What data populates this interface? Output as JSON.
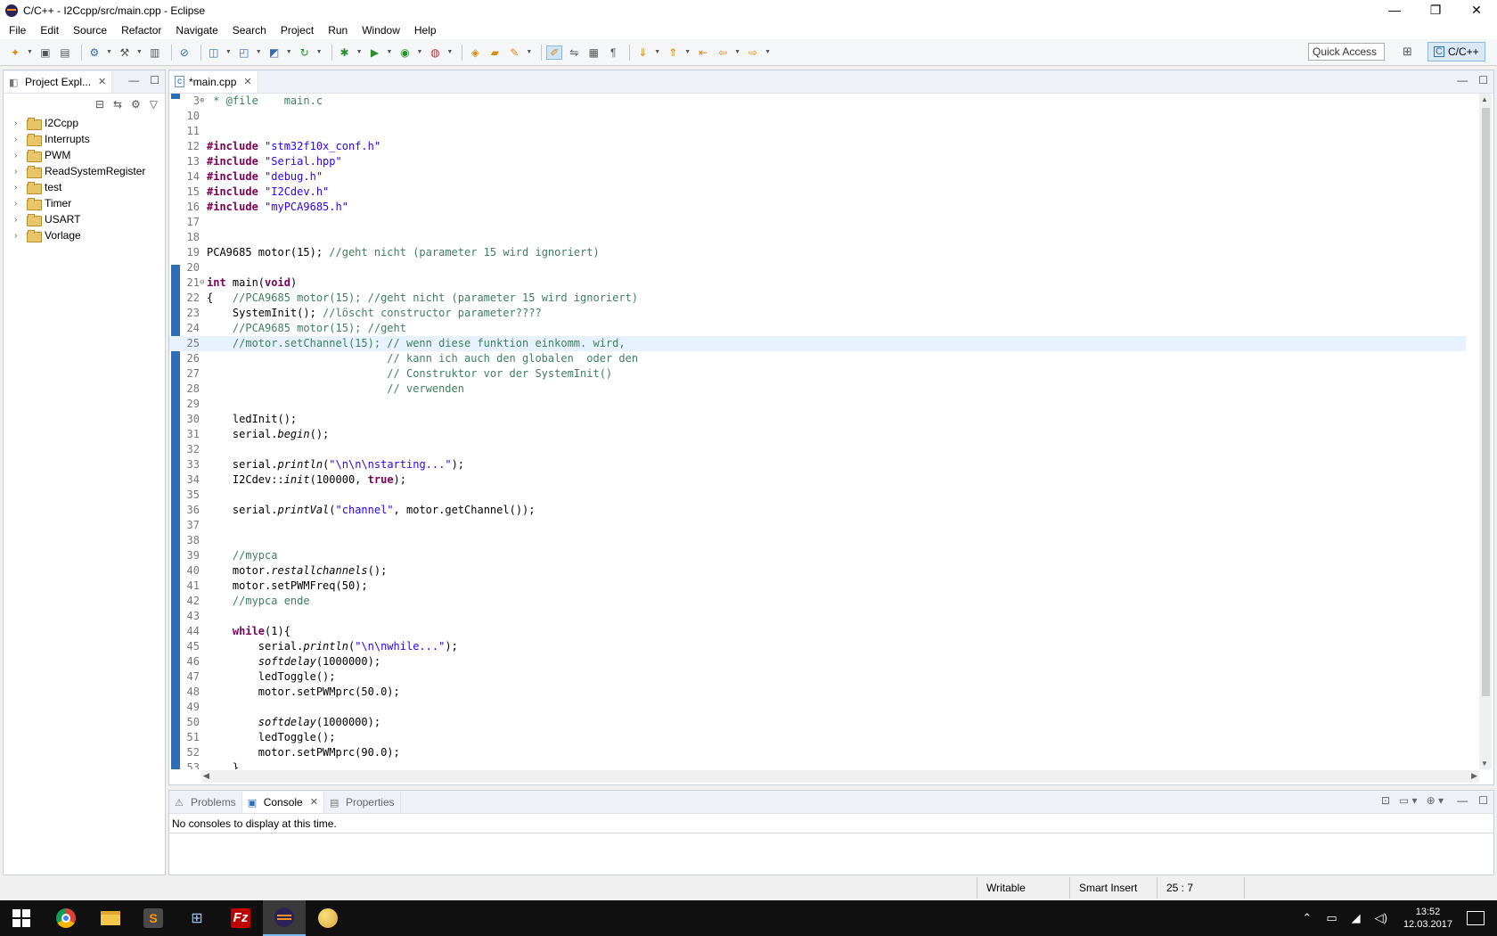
{
  "window": {
    "title": "C/C++ - I2Ccpp/src/main.cpp - Eclipse",
    "controls": [
      "—",
      "❐",
      "✕"
    ]
  },
  "menu": [
    "File",
    "Edit",
    "Source",
    "Refactor",
    "Navigate",
    "Search",
    "Project",
    "Run",
    "Window",
    "Help"
  ],
  "toolbar": {
    "quick_access": "Quick Access",
    "perspective": "C/C++",
    "accent": "#2f6db5"
  },
  "explorer": {
    "tab_label": "Project Expl...",
    "projects": [
      "I2Ccpp",
      "Interrupts",
      "PWM",
      "ReadSystemRegister",
      "test",
      "Timer",
      "USART",
      "Vorlage"
    ]
  },
  "editor": {
    "tab_label": "*main.cpp",
    "current_line": 25,
    "lines": [
      {
        "n": "3",
        "fold": "⊕",
        "parts": [
          [
            "cm",
            " * @file    main.c"
          ]
        ]
      },
      {
        "n": "10",
        "parts": []
      },
      {
        "n": "11",
        "parts": []
      },
      {
        "n": "12",
        "parts": [
          [
            "pp",
            "#include "
          ],
          [
            "str",
            "\"stm32f10x_conf.h\""
          ]
        ]
      },
      {
        "n": "13",
        "parts": [
          [
            "pp",
            "#include "
          ],
          [
            "str",
            "\"Serial.hpp\""
          ]
        ]
      },
      {
        "n": "14",
        "parts": [
          [
            "pp",
            "#include "
          ],
          [
            "str",
            "\"debug.h\""
          ]
        ]
      },
      {
        "n": "15",
        "parts": [
          [
            "pp",
            "#include "
          ],
          [
            "str",
            "\"I2Cdev.h\""
          ]
        ]
      },
      {
        "n": "16",
        "parts": [
          [
            "pp",
            "#include "
          ],
          [
            "str",
            "\"myPCA9685.h\""
          ]
        ]
      },
      {
        "n": "17",
        "parts": []
      },
      {
        "n": "18",
        "parts": []
      },
      {
        "n": "19",
        "parts": [
          [
            "",
            "PCA9685 motor(15); "
          ],
          [
            "cm",
            "//geht nicht (parameter 15 wird ignoriert)"
          ]
        ]
      },
      {
        "n": "20",
        "parts": []
      },
      {
        "n": "21",
        "fold": "⊖",
        "parts": [
          [
            "kw",
            "int"
          ],
          [
            "",
            " main("
          ],
          [
            "kw",
            "void"
          ],
          [
            "",
            ")"
          ]
        ]
      },
      {
        "n": "22",
        "parts": [
          [
            "",
            "{   "
          ],
          [
            "cm",
            "//PCA9685 motor(15); //geht nicht (parameter 15 wird ignoriert)"
          ]
        ]
      },
      {
        "n": "23",
        "parts": [
          [
            "",
            "    SystemInit(); "
          ],
          [
            "cm",
            "//löscht constructor parameter????"
          ]
        ]
      },
      {
        "n": "24",
        "parts": [
          [
            "cm",
            "    //PCA9685 motor(15); //geht"
          ]
        ]
      },
      {
        "n": "25",
        "parts": [
          [
            "cm",
            "    //motor.setChannel(15); // wenn diese funktion einkomm. wird,"
          ]
        ]
      },
      {
        "n": "26",
        "parts": [
          [
            "cm",
            "                            // kann ich auch den globalen  oder den"
          ]
        ]
      },
      {
        "n": "27",
        "parts": [
          [
            "cm",
            "                            // Construktor vor der SystemInit()"
          ]
        ]
      },
      {
        "n": "28",
        "parts": [
          [
            "cm",
            "                            // verwenden"
          ]
        ]
      },
      {
        "n": "29",
        "parts": []
      },
      {
        "n": "30",
        "parts": [
          [
            "",
            "    ledInit();"
          ]
        ]
      },
      {
        "n": "31",
        "parts": [
          [
            "",
            "    serial."
          ],
          [
            "it",
            "begin"
          ],
          [
            "",
            "();"
          ]
        ]
      },
      {
        "n": "32",
        "parts": []
      },
      {
        "n": "33",
        "parts": [
          [
            "",
            "    serial."
          ],
          [
            "it",
            "println"
          ],
          [
            "",
            "("
          ],
          [
            "str",
            "\"\\n\\n\\nstarting...\""
          ],
          [
            "",
            ");"
          ]
        ]
      },
      {
        "n": "34",
        "parts": [
          [
            "",
            "    I2Cdev::"
          ],
          [
            "it",
            "init"
          ],
          [
            "",
            "(100000, "
          ],
          [
            "kw",
            "true"
          ],
          [
            "",
            ");"
          ]
        ]
      },
      {
        "n": "35",
        "parts": []
      },
      {
        "n": "36",
        "parts": [
          [
            "",
            "    serial."
          ],
          [
            "it",
            "printVal"
          ],
          [
            "",
            "("
          ],
          [
            "str",
            "\"channel\""
          ],
          [
            "",
            ", motor.getChannel());"
          ]
        ]
      },
      {
        "n": "37",
        "parts": []
      },
      {
        "n": "38",
        "parts": []
      },
      {
        "n": "39",
        "parts": [
          [
            "cm",
            "    //mypca"
          ]
        ]
      },
      {
        "n": "40",
        "parts": [
          [
            "",
            "    motor."
          ],
          [
            "it",
            "restallchannels"
          ],
          [
            "",
            "();"
          ]
        ]
      },
      {
        "n": "41",
        "parts": [
          [
            "",
            "    motor.setPWMFreq(50);"
          ]
        ]
      },
      {
        "n": "42",
        "parts": [
          [
            "cm",
            "    //mypca ende"
          ]
        ]
      },
      {
        "n": "43",
        "parts": []
      },
      {
        "n": "44",
        "parts": [
          [
            "kw",
            "    while"
          ],
          [
            "",
            "(1){"
          ]
        ]
      },
      {
        "n": "45",
        "parts": [
          [
            "",
            "        serial."
          ],
          [
            "it",
            "println"
          ],
          [
            "",
            "("
          ],
          [
            "str",
            "\"\\n\\nwhile...\""
          ],
          [
            "",
            ");"
          ]
        ]
      },
      {
        "n": "46",
        "parts": [
          [
            "",
            "        "
          ],
          [
            "it",
            "softdelay"
          ],
          [
            "",
            "(1000000);"
          ]
        ]
      },
      {
        "n": "47",
        "parts": [
          [
            "",
            "        ledToggle();"
          ]
        ]
      },
      {
        "n": "48",
        "parts": [
          [
            "",
            "        motor.setPWMprc(50.0);"
          ]
        ]
      },
      {
        "n": "49",
        "parts": []
      },
      {
        "n": "50",
        "parts": [
          [
            "",
            "        "
          ],
          [
            "it",
            "softdelay"
          ],
          [
            "",
            "(1000000);"
          ]
        ]
      },
      {
        "n": "51",
        "parts": [
          [
            "",
            "        ledToggle();"
          ]
        ]
      },
      {
        "n": "52",
        "parts": [
          [
            "",
            "        motor.setPWMprc(90.0);"
          ]
        ]
      },
      {
        "n": "53",
        "parts": [
          [
            "",
            "    }"
          ]
        ]
      }
    ]
  },
  "bottom": {
    "tabs": [
      "Problems",
      "Console",
      "Properties"
    ],
    "active_tab": "Console",
    "message": "No consoles to display at this time."
  },
  "status": {
    "writable": "Writable",
    "insert_mode": "Smart Insert",
    "position": "25 : 7"
  },
  "taskbar": {
    "time": "13:52",
    "date": "12.03.2017"
  }
}
